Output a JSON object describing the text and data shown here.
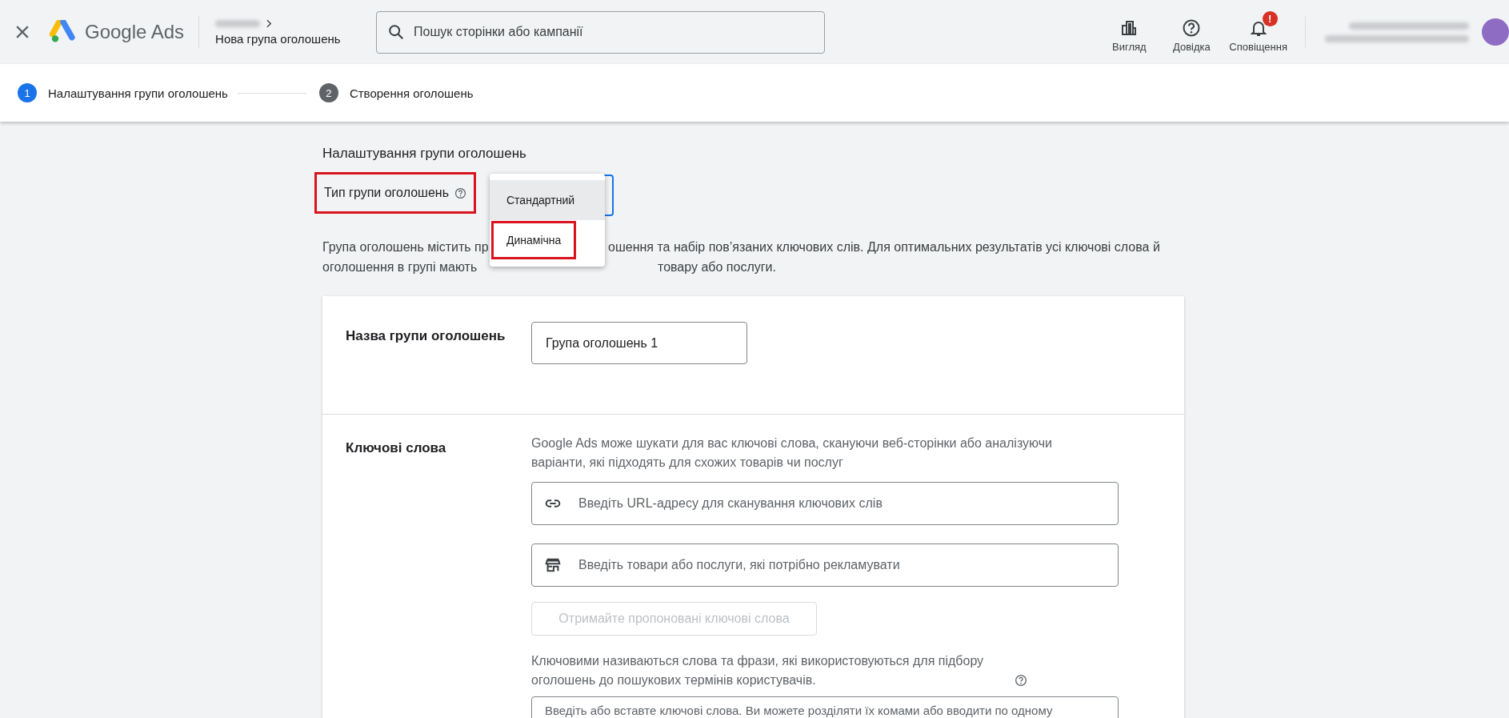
{
  "header": {
    "logo_text": "Google Ads",
    "breadcrumb_title": "Нова група оголошень",
    "search": {
      "placeholder": "Пошук сторінки або кампанії"
    },
    "actions": [
      {
        "kind": "view",
        "label": "Вигляд"
      },
      {
        "kind": "help",
        "label": "Довідка"
      },
      {
        "kind": "notifications",
        "label": "Сповіщення",
        "badge": "!"
      }
    ]
  },
  "steps": [
    {
      "number": "1",
      "label": "Налаштування групи оголошень",
      "selected": true
    },
    {
      "number": "2",
      "label": "Створення оголошень",
      "selected": false
    }
  ],
  "section_title": "Налаштування групи оголошень",
  "ad_group_type": {
    "label": "Тип групи оголошень",
    "highlighted": true,
    "options": [
      {
        "label": "Стандартний",
        "selected": true,
        "highlighted": false
      },
      {
        "label": "Динамічна",
        "selected": false,
        "highlighted": true
      }
    ]
  },
  "description_lines": [
    [
      "Група оголошень містить пр",
      "ошення та набір пов’язаних ключових слів. Для оптимальних результатів усі ключові слова й"
    ],
    [
      "оголошення в групі мають",
      "товару або послуги."
    ]
  ],
  "name_section": {
    "label": "Назва групи оголошень",
    "value": "Група оголошень 1"
  },
  "keywords_section": {
    "label": "Ключові слова",
    "description": "Google Ads може шукати для вас ключові слова, скануючи веб-сторінки або аналізуючи варіанти, які підходять для схожих товарів чи послуг",
    "url_field": {
      "placeholder": "Введіть URL-адресу для сканування ключових слів"
    },
    "products_field": {
      "placeholder": "Введіть товари або послуги, які потрібно рекламувати"
    },
    "suggest_button": {
      "label": "Отримайте пропоновані ключові слова",
      "disabled": true
    },
    "note": "Ключовими називаються слова та фрази, які використовуються для підбору оголошень до пошукових термінів користувачів.",
    "keywords_field": {
      "placeholder": "Введіть або вставте ключові слова. Ви можете розділяти їх комами або вводити по одному"
    }
  }
}
